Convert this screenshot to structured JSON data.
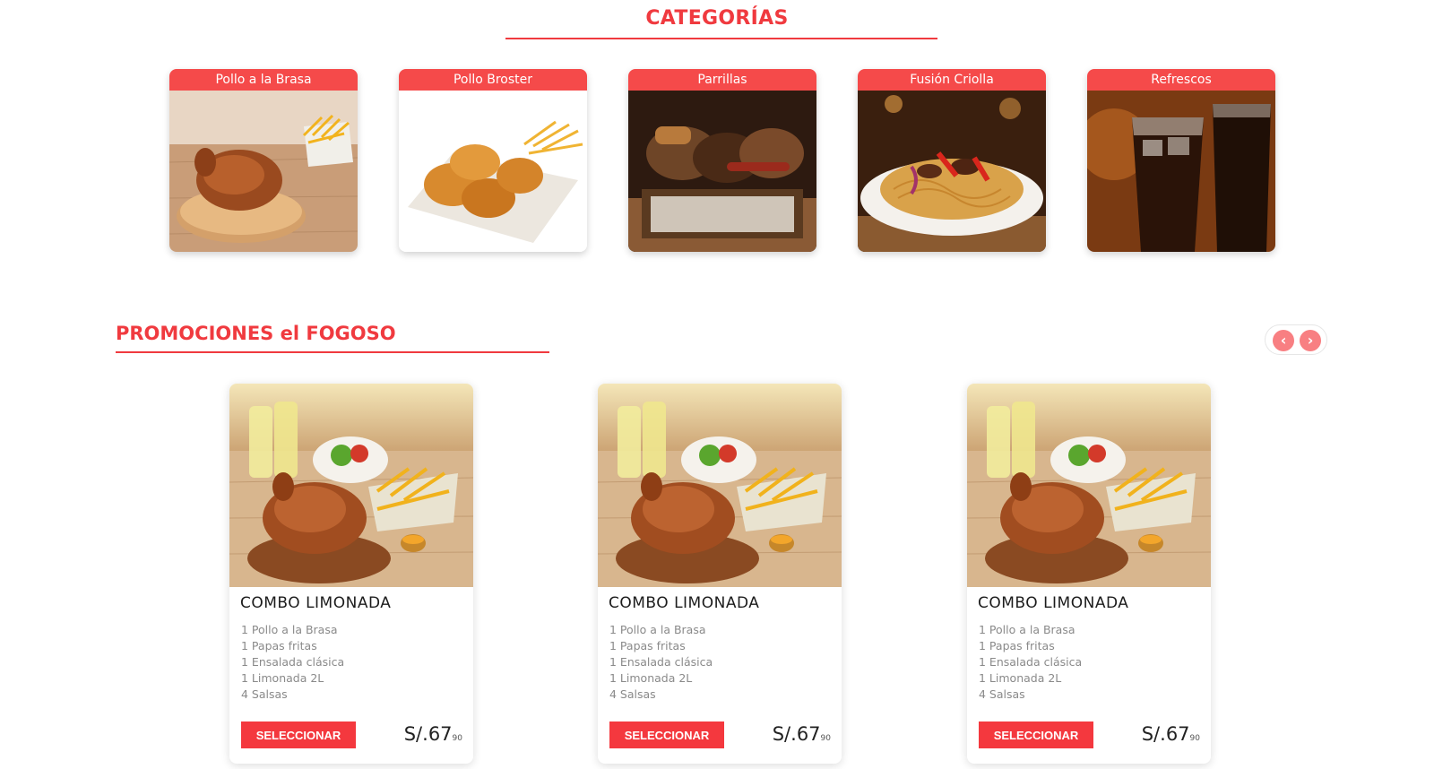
{
  "categories": {
    "title": "CATEGORÍAS",
    "items": [
      {
        "label": "Pollo a la Brasa"
      },
      {
        "label": "Pollo Broster"
      },
      {
        "label": "Parrillas"
      },
      {
        "label": "Fusión Criolla"
      },
      {
        "label": "Refrescos"
      }
    ]
  },
  "promotions": {
    "title": "PROMOCIONES el FOGOSO",
    "prev_icon": "chevron-left-icon",
    "next_icon": "chevron-right-icon",
    "cards": [
      {
        "name": "COMBO LIMONADA",
        "items": [
          "1 Pollo a la Brasa",
          "1 Papas fritas",
          "1 Ensalada clásica",
          "1 Limonada 2L",
          "4 Salsas"
        ],
        "button": "SELECCIONAR",
        "currency": "S/.",
        "price_int": "67",
        "price_dec": "90"
      },
      {
        "name": "COMBO LIMONADA",
        "items": [
          "1 Pollo a la Brasa",
          "1 Papas fritas",
          "1 Ensalada clásica",
          "1 Limonada 2L",
          "4 Salsas"
        ],
        "button": "SELECCIONAR",
        "currency": "S/.",
        "price_int": "67",
        "price_dec": "90"
      },
      {
        "name": "COMBO LIMONADA",
        "items": [
          "1 Pollo a la Brasa",
          "1 Papas fritas",
          "1 Ensalada clásica",
          "1 Limonada 2L",
          "4 Salsas"
        ],
        "button": "SELECCIONAR",
        "currency": "S/.",
        "price_int": "67",
        "price_dec": "90"
      }
    ]
  },
  "colors": {
    "accent": "#f03a3f",
    "label_bg": "#f54a4a",
    "arrow": "#f87f82"
  }
}
